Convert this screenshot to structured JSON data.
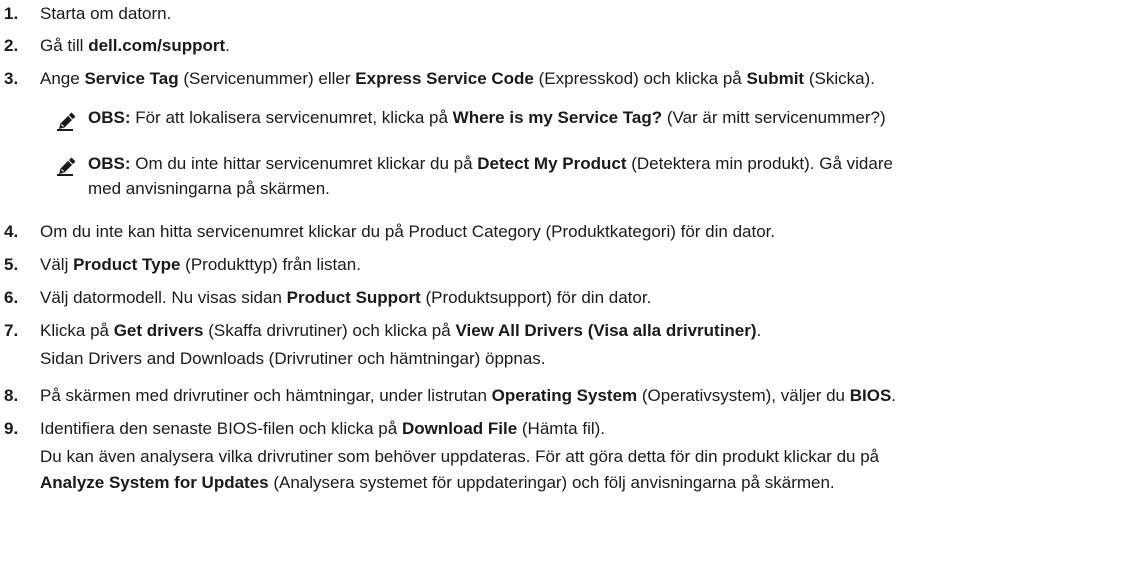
{
  "steps": [
    {
      "num": "1.",
      "parts": [
        {
          "t": "Starta om datorn."
        }
      ]
    },
    {
      "num": "2.",
      "parts": [
        {
          "t": "Gå till "
        },
        {
          "t": "dell.com/support",
          "b": true
        },
        {
          "t": "."
        }
      ]
    },
    {
      "num": "3.",
      "parts": [
        {
          "t": "Ange "
        },
        {
          "t": "Service Tag",
          "b": true
        },
        {
          "t": " (Servicenummer) eller "
        },
        {
          "t": "Express Service Code",
          "b": true
        },
        {
          "t": " (Expresskod) och klicka på "
        },
        {
          "t": "Submit",
          "b": true
        },
        {
          "t": " (Skicka)."
        }
      ]
    },
    {
      "num": "4.",
      "parts": [
        {
          "t": "Om du inte kan hitta servicenumret klickar du på Product Category (Produktkategori) för din dator."
        }
      ]
    },
    {
      "num": "5.",
      "parts": [
        {
          "t": "Välj "
        },
        {
          "t": "Product Type",
          "b": true
        },
        {
          "t": " (Produkttyp) från listan."
        }
      ]
    },
    {
      "num": "6.",
      "parts": [
        {
          "t": "Välj datormodell. Nu visas sidan "
        },
        {
          "t": "Product Support",
          "b": true
        },
        {
          "t": " (Produktsupport) för din dator."
        }
      ]
    },
    {
      "num": "7.",
      "parts": [
        {
          "t": "Klicka på "
        },
        {
          "t": "Get drivers",
          "b": true
        },
        {
          "t": " (Skaffa drivrutiner) och klicka på "
        },
        {
          "t": "View All Drivers (Visa alla drivrutiner)",
          "b": true
        },
        {
          "t": "."
        }
      ]
    },
    {
      "num": "8.",
      "parts": [
        {
          "t": "På skärmen med drivrutiner och hämtningar, under listrutan "
        },
        {
          "t": "Operating System",
          "b": true
        },
        {
          "t": " (Operativsystem), väljer du "
        },
        {
          "t": "BIOS",
          "b": true
        },
        {
          "t": "."
        }
      ]
    },
    {
      "num": "9.",
      "parts": [
        {
          "t": "Identifiera den senaste BIOS-filen och klicka på "
        },
        {
          "t": "Download File",
          "b": true
        },
        {
          "t": " (Hämta fil)."
        }
      ]
    }
  ],
  "notes": [
    {
      "lines": [
        [
          {
            "t": "OBS:",
            "b": true
          },
          {
            "t": " För att lokalisera servicenumret, klicka på "
          },
          {
            "t": "Where is my Service Tag?",
            "b": true
          },
          {
            "t": " (Var är mitt servicenummer?)"
          }
        ]
      ]
    },
    {
      "lines": [
        [
          {
            "t": "OBS:",
            "b": true
          },
          {
            "t": " Om du inte hittar servicenumret klickar du på "
          },
          {
            "t": "Detect My Product",
            "b": true
          },
          {
            "t": " (Detektera min produkt). Gå vidare"
          }
        ],
        [
          {
            "t": "med anvisningarna på skärmen."
          }
        ]
      ]
    }
  ],
  "continuations": {
    "step7": [
      [
        {
          "t": "Sidan Drivers and Downloads (Drivrutiner och hämtningar) öppnas."
        }
      ]
    ],
    "step9": [
      [
        {
          "t": "Du kan även analysera vilka drivrutiner som behöver uppdateras. För att göra detta för din produkt klickar du på"
        }
      ],
      [
        {
          "t": "Analyze System for Updates",
          "b": true
        },
        {
          "t": " (Analysera systemet för uppdateringar) och följ anvisningarna på skärmen."
        }
      ]
    ]
  },
  "note_icon": "pencil-note-icon"
}
